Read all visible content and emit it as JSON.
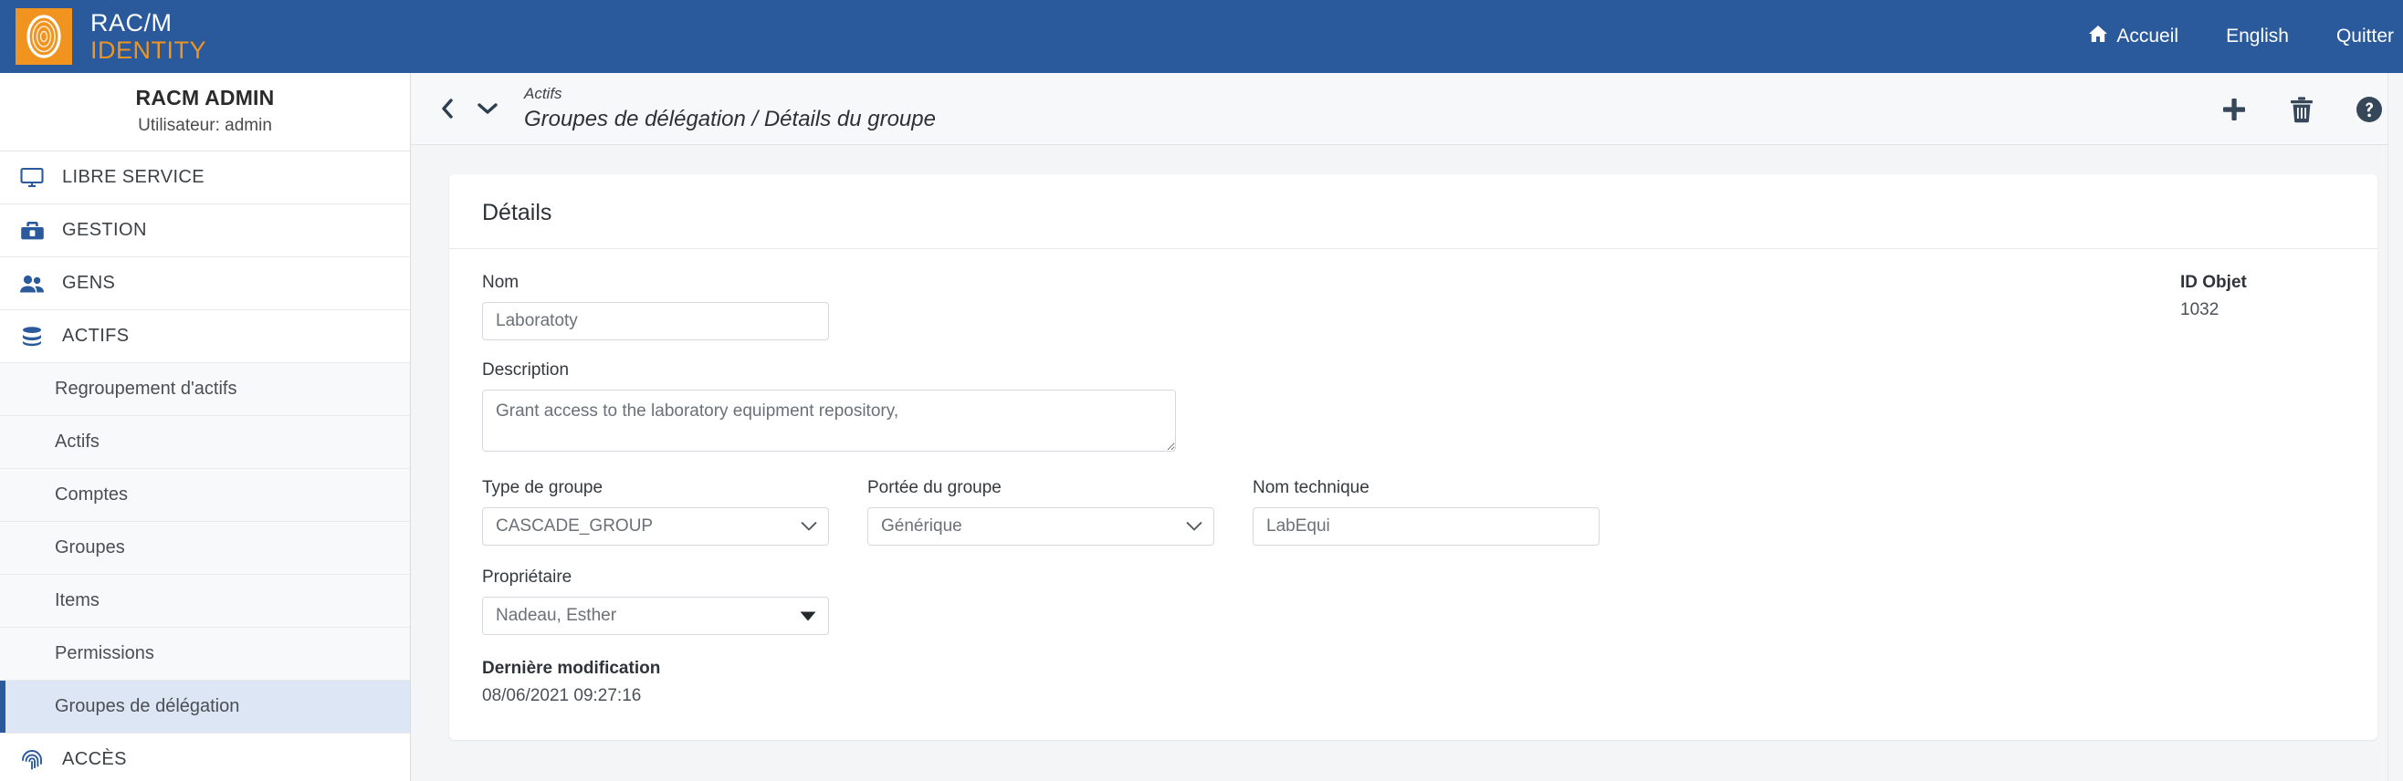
{
  "topbar": {
    "logo": {
      "icon": "fingerprint-logo-icon",
      "line1": "RAC/M",
      "line2": "IDENTITY"
    },
    "nav": [
      {
        "icon": "home-icon",
        "label": "Accueil"
      },
      {
        "icon": "",
        "label": "English"
      },
      {
        "icon": "",
        "label": "Quitter"
      }
    ]
  },
  "sidebar": {
    "user": {
      "name": "RACM ADMIN",
      "subtitle": "Utilisateur: admin"
    },
    "sections": [
      {
        "icon": "monitor-icon",
        "label": "LIBRE SERVICE"
      },
      {
        "icon": "toolbox-icon",
        "label": "GESTION"
      },
      {
        "icon": "people-icon",
        "label": "GENS"
      },
      {
        "icon": "database-icon",
        "label": "ACTIFS"
      }
    ],
    "sub_items": [
      {
        "label": "Regroupement d'actifs",
        "selected": false
      },
      {
        "label": "Actifs",
        "selected": false
      },
      {
        "label": "Comptes",
        "selected": false
      },
      {
        "label": "Groupes",
        "selected": false
      },
      {
        "label": "Items",
        "selected": false
      },
      {
        "label": "Permissions",
        "selected": false
      },
      {
        "label": "Groupes de délégation",
        "selected": true
      }
    ],
    "section_after": {
      "icon": "fingerprint-icon",
      "label": "ACCÈS"
    }
  },
  "breadcrumb": {
    "back_icon": "chevron-left-icon",
    "dropdown_icon": "chevron-down-icon",
    "parent": "Actifs",
    "current": "Groupes de délégation / Détails du groupe",
    "actions": [
      {
        "icon": "plus-icon",
        "name": "add-button"
      },
      {
        "icon": "trash-icon",
        "name": "delete-button"
      },
      {
        "icon": "help-circle-icon",
        "name": "help-button"
      }
    ]
  },
  "details_card": {
    "title": "Détails",
    "id_object": {
      "label": "ID Objet",
      "value": "1032"
    },
    "fields": {
      "nom": {
        "label": "Nom",
        "value": "Laboratoty",
        "placeholder": "Nom"
      },
      "description": {
        "label": "Description",
        "value": "Grant access to the laboratory equipment repository,",
        "placeholder": "Description"
      },
      "type_de_groupe": {
        "label": "Type de groupe",
        "value": "CASCADE_GROUP"
      },
      "portee_du_groupe": {
        "label": "Portée du groupe",
        "value": "Générique"
      },
      "nom_technique": {
        "label": "Nom technique",
        "value": "LabEqui",
        "placeholder": "Nom technique"
      },
      "proprietaire": {
        "label": "Propriétaire",
        "value": "Nadeau, Esther"
      },
      "derniere_modification": {
        "label": "Dernière modification",
        "value": "08/06/2021 09:27:16"
      }
    }
  },
  "colors": {
    "header_blue": "#2a5a9c",
    "accent_orange": "#f0941f",
    "selected_item_bg": "#dce6f5",
    "page_bg": "#f4f5f7"
  }
}
